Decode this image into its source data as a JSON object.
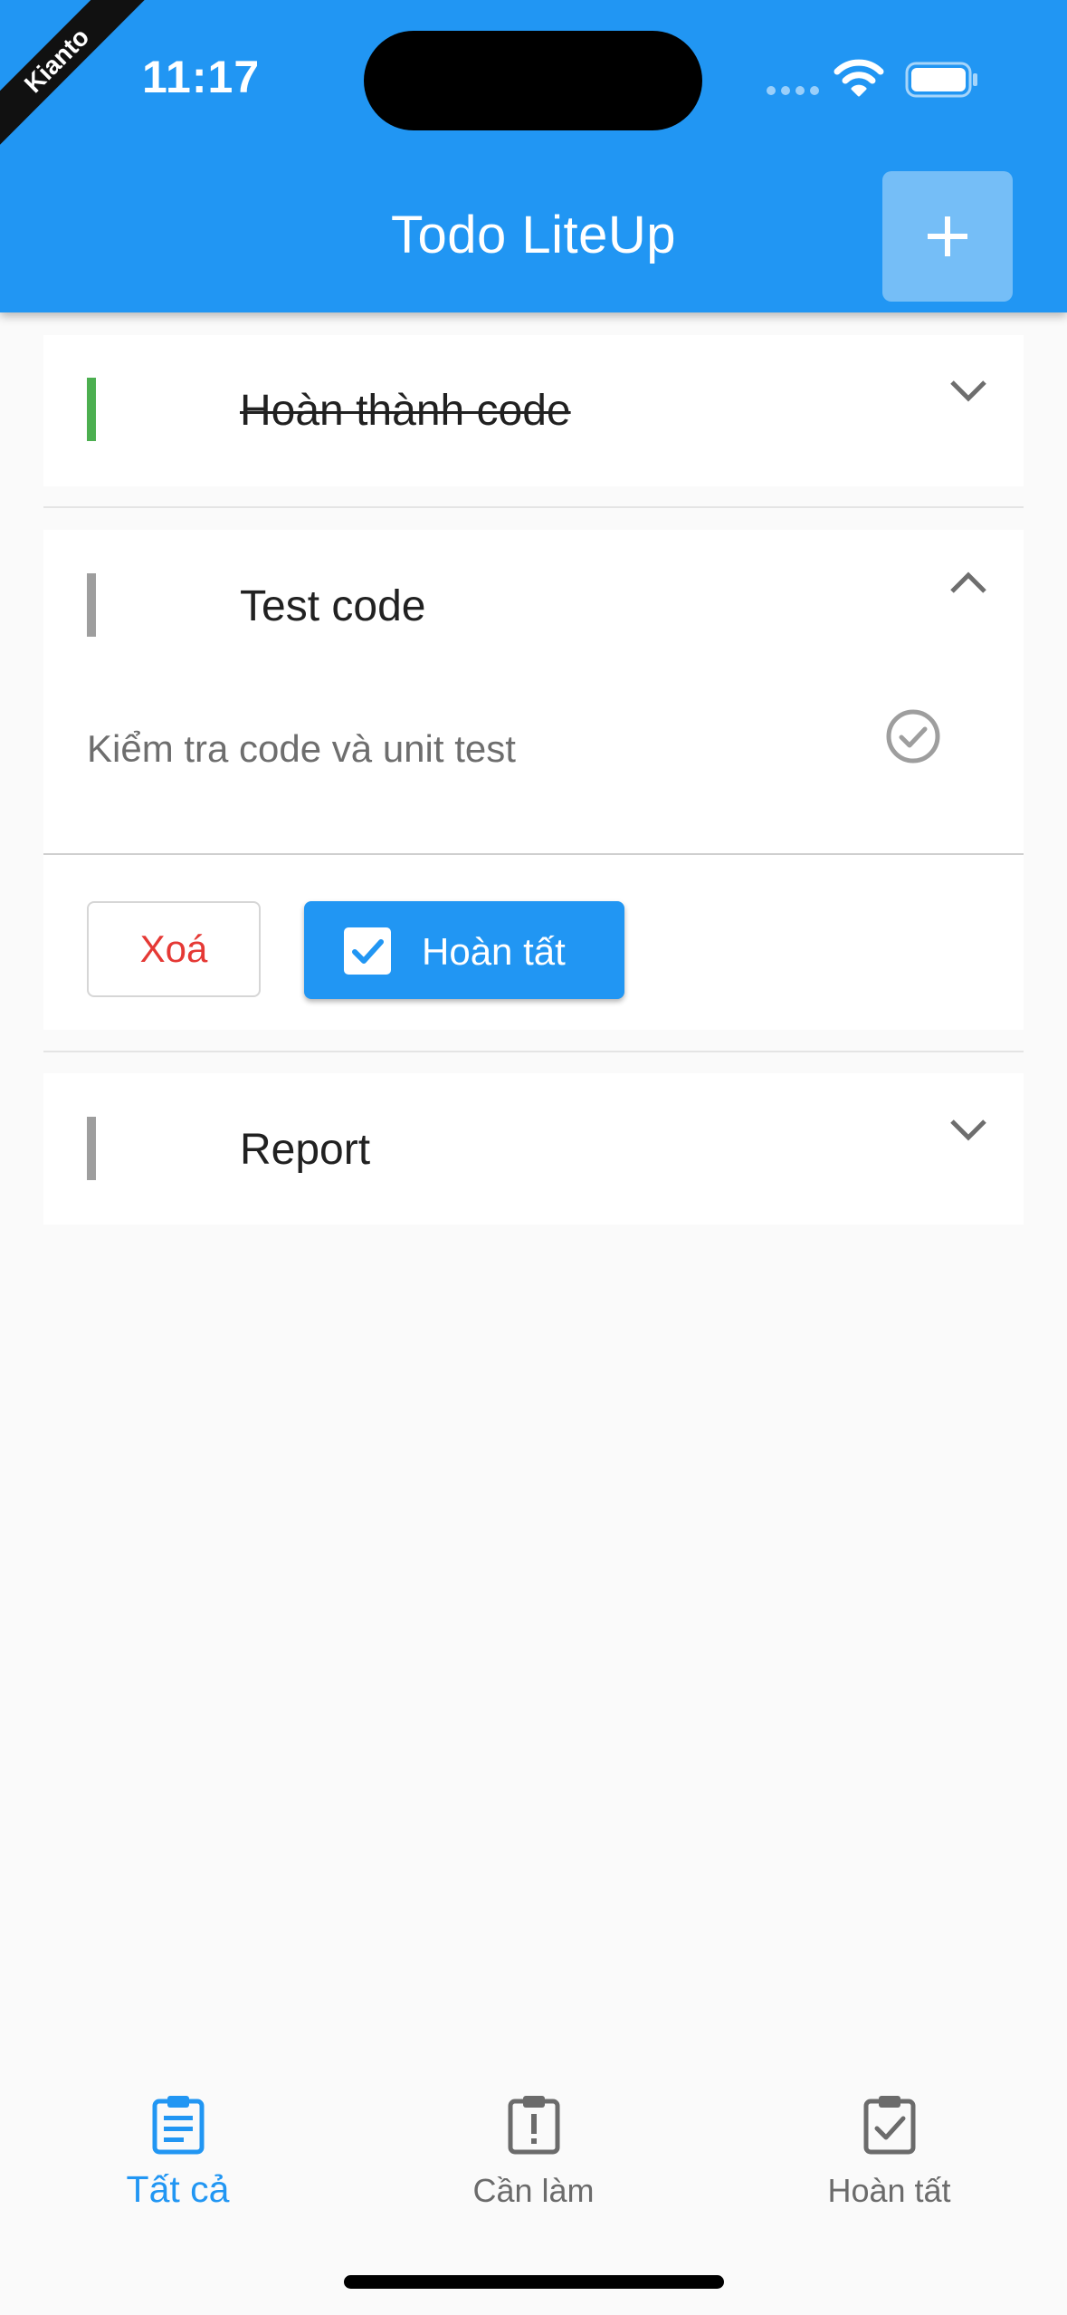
{
  "status_bar": {
    "time": "11:17"
  },
  "debug_ribbon": "Kianto",
  "app_bar": {
    "title": "Todo LiteUp",
    "add_icon": "plus-icon"
  },
  "colors": {
    "primary": "#2196f3",
    "done_accent": "#4caf50",
    "pending_accent": "#9e9e9e",
    "delete_text": "#e53935"
  },
  "todos": [
    {
      "title": "Hoàn thành code",
      "completed": true,
      "expanded": false,
      "accent": "#4caf50"
    },
    {
      "title": "Test code",
      "completed": false,
      "expanded": true,
      "accent": "#9e9e9e",
      "description": "Kiểm tra code và unit test",
      "delete_label": "Xoá",
      "complete_label": "Hoàn tất",
      "complete_checked": true
    },
    {
      "title": "Report",
      "completed": false,
      "expanded": false,
      "accent": "#9e9e9e"
    }
  ],
  "bottom_nav": {
    "selected_index": 0,
    "items": [
      {
        "label": "Tất cả",
        "icon": "clipboard-list-icon"
      },
      {
        "label": "Cần làm",
        "icon": "clipboard-alert-icon"
      },
      {
        "label": "Hoàn tất",
        "icon": "clipboard-check-icon"
      }
    ]
  }
}
